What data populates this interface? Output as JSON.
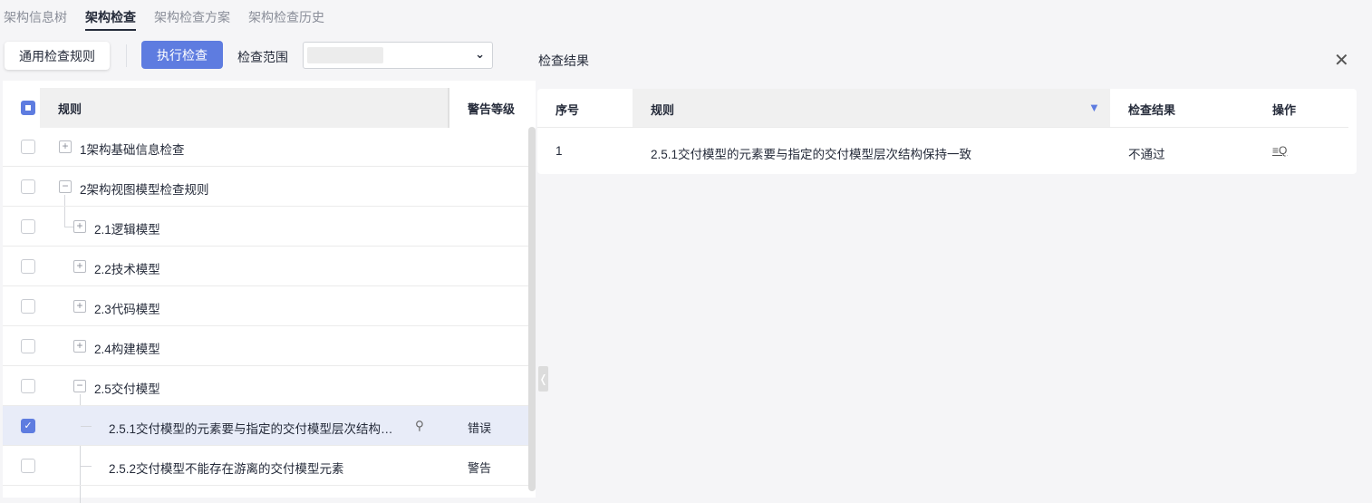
{
  "tabs": [
    "架构信息树",
    "架构检查",
    "架构检查方案",
    "架构检查历史"
  ],
  "active_tab": 1,
  "toolbar": {
    "general_rules": "通用检查规则",
    "run_check": "执行检查",
    "scope_label": "检查范围"
  },
  "tree": {
    "headers": {
      "rule": "规则",
      "level": "警告等级"
    },
    "rows": [
      {
        "label": "1架构基础信息检查",
        "level": ""
      },
      {
        "label": "2架构视图模型检查规则",
        "level": ""
      },
      {
        "label": "2.1逻辑模型",
        "level": ""
      },
      {
        "label": "2.2技术模型",
        "level": ""
      },
      {
        "label": "2.3代码模型",
        "level": ""
      },
      {
        "label": "2.4构建模型",
        "level": ""
      },
      {
        "label": "2.5交付模型",
        "level": ""
      },
      {
        "label": "2.5.1交付模型的元素要与指定的交付模型层次结构…",
        "level": "错误"
      },
      {
        "label": "2.5.2交付模型不能存在游离的交付模型元素",
        "level": "警告"
      }
    ]
  },
  "result": {
    "title": "检查结果",
    "headers": {
      "no": "序号",
      "rule": "规则",
      "result": "检查结果",
      "action": "操作"
    },
    "rows": [
      {
        "no": "1",
        "rule": "2.5.1交付模型的元素要与指定的交付模型层次结构保持一致",
        "result": "不通过"
      }
    ]
  },
  "colors": {
    "accent": "#5e7ce0"
  }
}
